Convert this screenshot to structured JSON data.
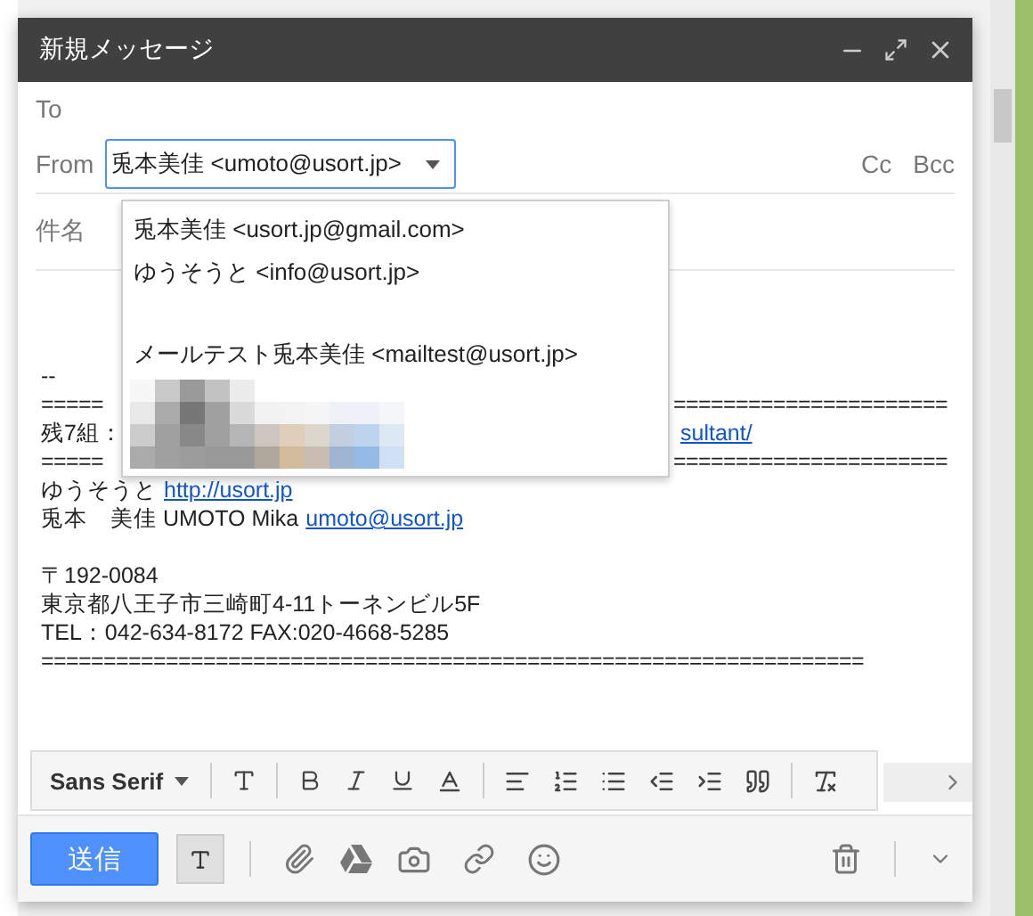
{
  "window": {
    "title": "新規メッセージ"
  },
  "to": {
    "label": "To"
  },
  "from": {
    "label": "From",
    "value": "兎本美佳 <umoto@usort.jp>",
    "expanded": true
  },
  "cc_links": [
    "Cc",
    "Bcc"
  ],
  "subject": {
    "placeholder": "件名"
  },
  "from_options": [
    {
      "kind": "address",
      "label": "兎本美佳 <usort.jp@gmail.com>"
    },
    {
      "kind": "address",
      "label": "ゆうそうと <info@usort.jp>"
    },
    {
      "kind": "blank"
    },
    {
      "kind": "address",
      "label": "メールテスト兎本美佳 <mailtest@usort.jp>"
    },
    {
      "kind": "picture"
    }
  ],
  "body": [
    {
      "kind": "text",
      "text": "--"
    },
    {
      "kind": "rule",
      "text": "=====",
      "right": "======================"
    },
    {
      "kind": "split",
      "text": "残7組：",
      "link": "sultant/"
    },
    {
      "kind": "rule",
      "text": "=====",
      "right": "======================"
    },
    {
      "kind": "text",
      "text": "ゆうそうと",
      "link": "http://usort.jp"
    },
    {
      "kind": "text",
      "text": "兎本　美佳 UMOTO Mika",
      "link": "umoto@usort.jp"
    },
    {
      "kind": "blank"
    },
    {
      "kind": "text",
      "text": "〒192-0084"
    },
    {
      "kind": "text",
      "text": "東京都八王子市三崎町4-11トーネンビル5F"
    },
    {
      "kind": "text",
      "text": "TEL：042-634-8172 FAX:020-4668-5285"
    },
    {
      "kind": "rule",
      "text": "=================================================================="
    }
  ],
  "format_toolbar": {
    "font": "Sans Serif"
  },
  "send_button": "送信"
}
